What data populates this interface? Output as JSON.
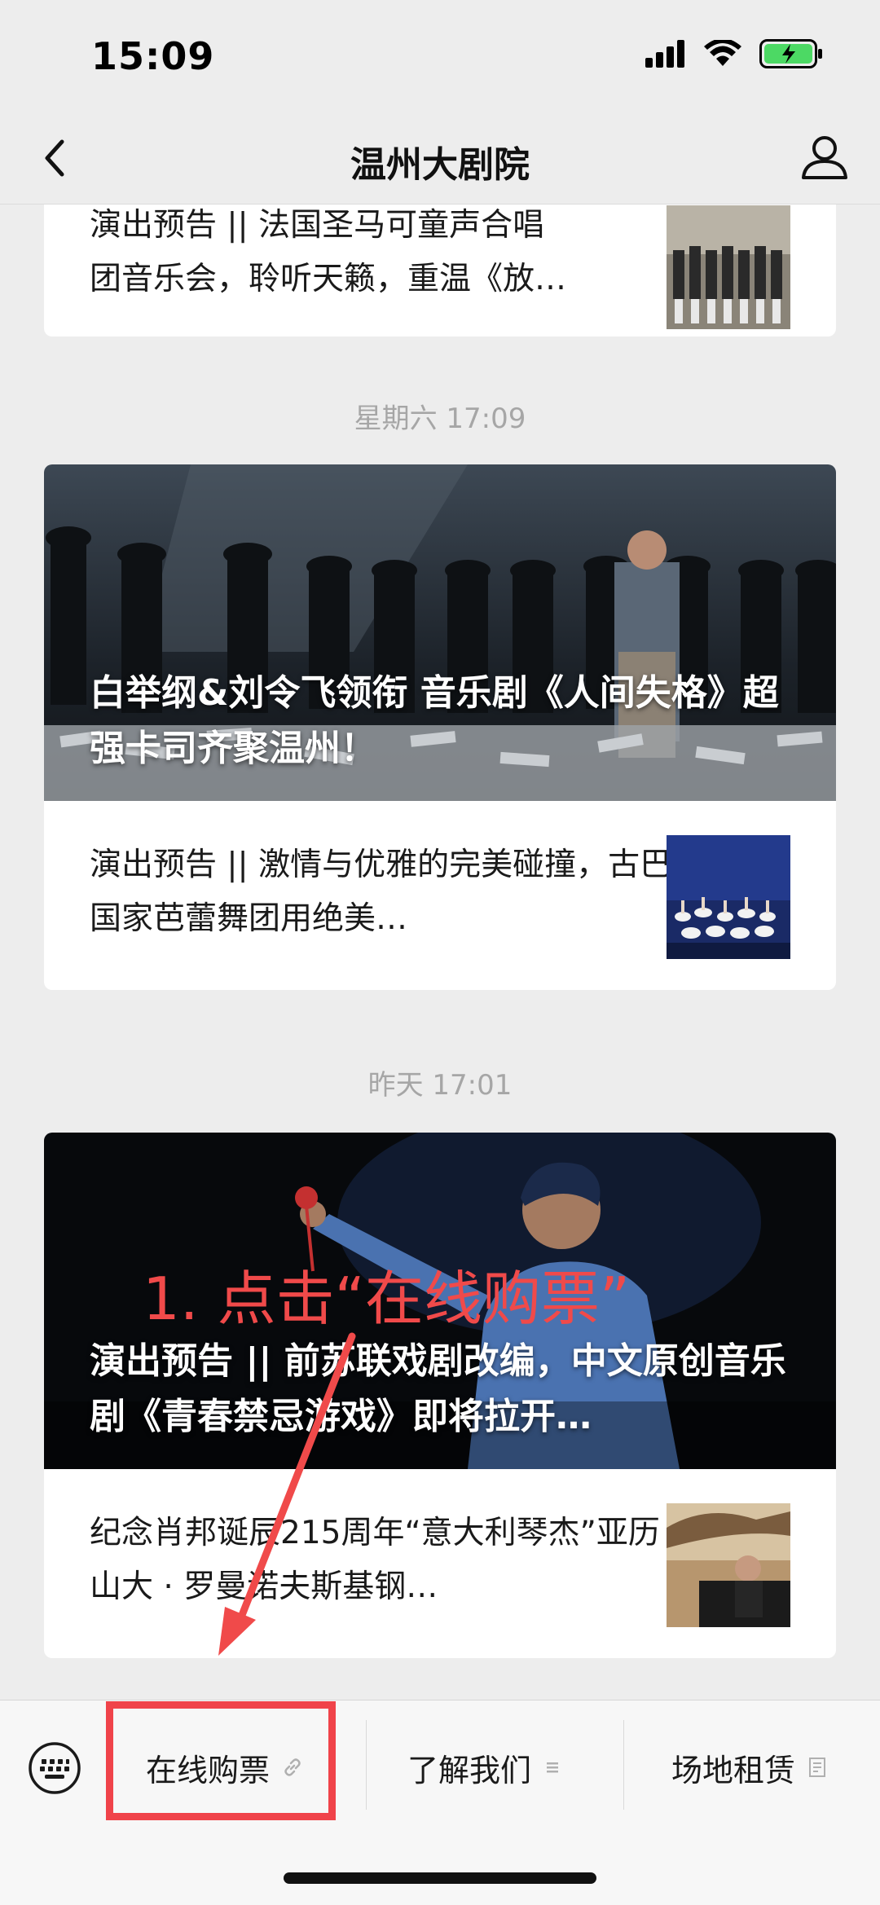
{
  "status_bar": {
    "time": "15:09"
  },
  "nav": {
    "title": "温州大剧院"
  },
  "feed": {
    "top_item": {
      "line1": "演出预告 || 法国圣马可童声合唱",
      "line2": "团音乐会，聆听天籁，重温《放…"
    },
    "groups": [
      {
        "timestamp": "星期六 17:09",
        "hero_title": "白举纲&刘令飞领衔 音乐剧《人间失格》超强卡司齐聚温州！",
        "item_text": "演出预告 || 激情与优雅的完美碰撞，古巴国家芭蕾舞团用绝美…"
      },
      {
        "timestamp": "昨天 17:01",
        "hero_title": "演出预告 || 前苏联戏剧改编，中文原创音乐剧《青春禁忌游戏》即将拉开…",
        "item_text": "纪念肖邦诞辰215周年“意大利琴杰”亚历山大 · 罗曼诺夫斯基钢…"
      }
    ]
  },
  "annotation": {
    "text": "1. 点击“在线购票”"
  },
  "menu": {
    "items": [
      {
        "label": "在线购票",
        "icon": "link-icon"
      },
      {
        "label": "了解我们",
        "icon": "list-icon"
      },
      {
        "label": "场地租赁",
        "icon": "document-icon"
      }
    ]
  },
  "colors": {
    "accent_red": "#f0434a",
    "battery_green": "#4cd964"
  }
}
